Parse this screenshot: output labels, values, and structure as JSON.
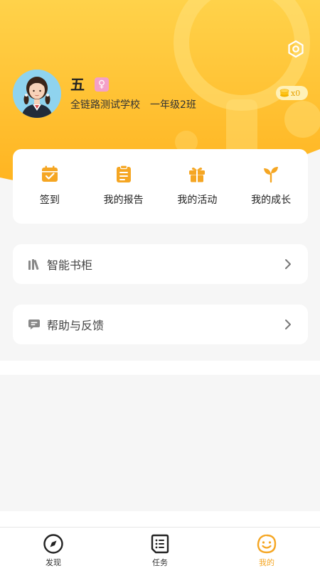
{
  "profile": {
    "name": "五",
    "gender_symbol": "♀",
    "school": "全链路测试学校",
    "class_name": "一年级2班",
    "coin_prefix": "x",
    "coin_count": "0"
  },
  "colors": {
    "header_gradient_top": "#ffd24a",
    "header_gradient_bottom": "#ffb31f",
    "accent": "#f5a623",
    "gender_badge": "#f4a0c8"
  },
  "menu": {
    "items": [
      {
        "label": "签到",
        "icon": "calendar-check-icon"
      },
      {
        "label": "我的报告",
        "icon": "report-icon"
      },
      {
        "label": "我的活动",
        "icon": "gift-icon"
      },
      {
        "label": "我的成长",
        "icon": "sprout-icon"
      }
    ]
  },
  "list": {
    "bookshelf": {
      "label": "智能书柜",
      "icon": "bookshelf-icon"
    },
    "help": {
      "label": "帮助与反馈",
      "icon": "chat-bubble-icon"
    }
  },
  "tabbar": {
    "items": [
      {
        "label": "发现",
        "icon": "compass-icon",
        "active": false
      },
      {
        "label": "任务",
        "icon": "task-list-icon",
        "active": false
      },
      {
        "label": "我的",
        "icon": "smile-face-icon",
        "active": true
      }
    ]
  }
}
